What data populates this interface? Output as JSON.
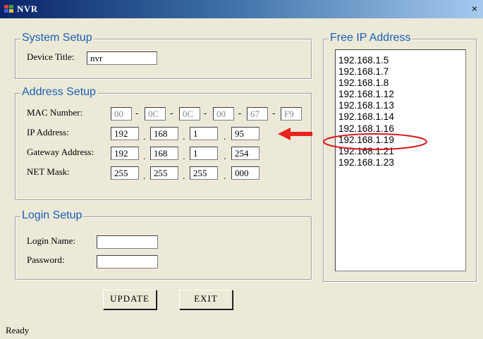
{
  "window": {
    "title": "NVR",
    "close_label": "×"
  },
  "system_setup": {
    "title": "System Setup",
    "device_title_label": "Device Title:",
    "device_title_value": "nvr"
  },
  "address_setup": {
    "title": "Address Setup",
    "mac_label": "MAC Number:",
    "mac": [
      "00",
      "0C",
      "0C",
      "00",
      "67",
      "F9"
    ],
    "ip_label": "IP Address:",
    "ip": [
      "192",
      "168",
      "1",
      "95"
    ],
    "gateway_label": "Gateway Address:",
    "gateway": [
      "192",
      "168",
      "1",
      "254"
    ],
    "netmask_label": "NET Mask:",
    "netmask": [
      "255",
      "255",
      "255",
      "000"
    ],
    "mac_separator": "-",
    "ip_separator": "."
  },
  "login_setup": {
    "title": "Login Setup",
    "login_name_label": "Login Name:",
    "login_name_value": "",
    "password_label": "Password:",
    "password_value": ""
  },
  "buttons": {
    "update": "UPDATE",
    "exit": "EXIT"
  },
  "free_ip": {
    "title": "Free IP Address",
    "items": [
      "192.168.1.5",
      "192.168.1.7",
      "192.168.1.8",
      "192.168.1.12",
      "192.168.1.13",
      "192.168.1.14",
      "192.168.1.16",
      "192.168.1.19",
      "192.168.1.21",
      "192.168.1.23"
    ],
    "highlighted": "192.168.1.16"
  },
  "annotation": {
    "arrow_color": "#E8231E",
    "ellipse_color": "#D8161E"
  },
  "status_bar": {
    "text": "Ready"
  }
}
